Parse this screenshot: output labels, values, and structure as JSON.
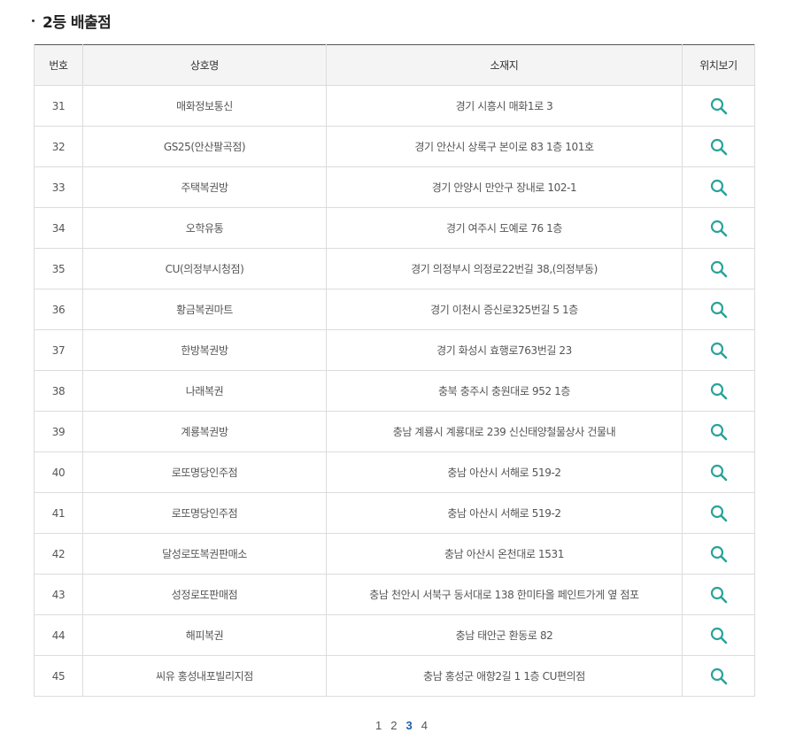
{
  "section": {
    "title": "2등 배출점"
  },
  "table": {
    "headers": {
      "no": "번호",
      "name": "상호명",
      "address": "소재지",
      "view": "위치보기"
    },
    "rows": [
      {
        "no": "31",
        "name": "매화정보통신",
        "address": "경기 시흥시 매화1로 3"
      },
      {
        "no": "32",
        "name": "GS25(안산팔곡점)",
        "address": "경기 안산시 상록구 본이로 83 1층 101호"
      },
      {
        "no": "33",
        "name": "주택복권방",
        "address": "경기 안양시 만안구 장내로 102-1"
      },
      {
        "no": "34",
        "name": "오학유통",
        "address": "경기 여주시 도예로 76 1층"
      },
      {
        "no": "35",
        "name": "CU(의정부시청점)",
        "address": "경기 의정부시 의정로22번길 38,(의정부동)"
      },
      {
        "no": "36",
        "name": "황금복권마트",
        "address": "경기 이천시 증신로325번길 5 1층"
      },
      {
        "no": "37",
        "name": "한방복권방",
        "address": "경기 화성시 효행로763번길 23"
      },
      {
        "no": "38",
        "name": "나래복권",
        "address": "충북 충주시 충원대로 952 1층"
      },
      {
        "no": "39",
        "name": "계룡복권방",
        "address": "충남 계룡시 계룡대로 239 신신태양철물상사 건물내"
      },
      {
        "no": "40",
        "name": "로또명당인주점",
        "address": "충남 아산시 서해로 519-2"
      },
      {
        "no": "41",
        "name": "로또명당인주점",
        "address": "충남 아산시 서해로 519-2"
      },
      {
        "no": "42",
        "name": "달성로또복권판매소",
        "address": "충남 아산시 온천대로 1531"
      },
      {
        "no": "43",
        "name": "성정로또판매점",
        "address": "충남 천안시 서북구 동서대로 138 한미타올 페인트가게 옆 점포"
      },
      {
        "no": "44",
        "name": "해피복권",
        "address": "충남 태안군 환동로 82"
      },
      {
        "no": "45",
        "name": "씨유 홍성내포빌리지점",
        "address": "충남 홍성군 애향2길 1 1층 CU편의점"
      }
    ],
    "view_icon": "search-icon",
    "icon_color": "#2aa39a"
  },
  "pagination": {
    "pages": [
      "1",
      "2",
      "3",
      "4"
    ],
    "current": "3",
    "current_color": "#1f5fa6"
  }
}
